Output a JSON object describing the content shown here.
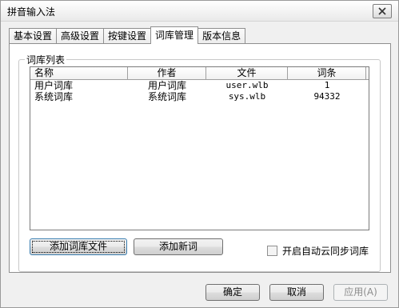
{
  "window": {
    "title": "拼音输入法"
  },
  "tabs": [
    {
      "label": "基本设置"
    },
    {
      "label": "高级设置"
    },
    {
      "label": "按键设置"
    },
    {
      "label": "词库管理"
    },
    {
      "label": "版本信息"
    }
  ],
  "active_tab": "词库管理",
  "dictionary_list": {
    "group_label": "词库列表",
    "columns": [
      "名称",
      "作者",
      "文件",
      "词条"
    ],
    "rows": [
      {
        "name": "用户词库",
        "author": "用户词库",
        "file": "user.wlb",
        "entries": "1"
      },
      {
        "name": "系统词库",
        "author": "系统词库",
        "file": "sys.wlb",
        "entries": "94332"
      }
    ]
  },
  "buttons": {
    "add_dict_file": "添加词库文件",
    "add_new_word": "添加新词",
    "ok": "确定",
    "cancel": "取消",
    "apply": "应用(A)"
  },
  "cloud_sync": {
    "label": "开启自动云同步词库",
    "checked": false
  },
  "icons": {
    "close": "close-icon"
  }
}
